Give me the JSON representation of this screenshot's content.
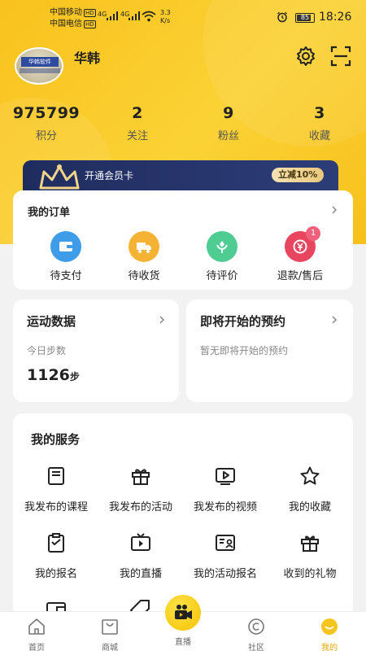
{
  "status": {
    "carrier1": "中国移动",
    "carrier2": "中国电信",
    "hd": "HD",
    "net": "4G",
    "speed_value": "3.3",
    "speed_unit": "K/s",
    "battery": "85",
    "time": "18:26"
  },
  "profile": {
    "avatar_text": "华韩软件",
    "username": "华韩"
  },
  "stats": [
    {
      "value": "975799",
      "label": "积分"
    },
    {
      "value": "2",
      "label": "关注"
    },
    {
      "value": "9",
      "label": "粉丝"
    },
    {
      "value": "3",
      "label": "收藏"
    }
  ],
  "vip": {
    "text": "开通会员卡",
    "tag": "立减10%"
  },
  "orders": {
    "title": "我的订单",
    "items": [
      {
        "label": "待支付",
        "icon": "wallet-icon",
        "color": "#3f9ce8"
      },
      {
        "label": "待收货",
        "icon": "truck-icon",
        "color": "#f5b335"
      },
      {
        "label": "待评价",
        "icon": "flower-icon",
        "color": "#4fcc91"
      },
      {
        "label": "退款/售后",
        "icon": "refund-icon",
        "color": "#e8465f",
        "badge": "1"
      }
    ]
  },
  "sport": {
    "title": "运动数据",
    "sub": "今日步数",
    "steps": "1126",
    "unit": "步"
  },
  "appointment": {
    "title": "即将开始的预约",
    "empty": "暂无即将开始的预约"
  },
  "services": {
    "title": "我的服务",
    "items": [
      {
        "label": "我发布的课程",
        "icon": "course-icon"
      },
      {
        "label": "我发布的活动",
        "icon": "gift-box-icon"
      },
      {
        "label": "我发布的视频",
        "icon": "video-icon"
      },
      {
        "label": "我的收藏",
        "icon": "star-icon"
      },
      {
        "label": "我的报名",
        "icon": "clipboard-icon"
      },
      {
        "label": "我的直播",
        "icon": "tv-icon"
      },
      {
        "label": "我的活动报名",
        "icon": "id-card-icon"
      },
      {
        "label": "收到的礼物",
        "icon": "gift-icon"
      }
    ]
  },
  "tabs": [
    {
      "label": "首页",
      "icon": "home-icon"
    },
    {
      "label": "商城",
      "icon": "shop-bag-icon"
    },
    {
      "label": "直播",
      "icon": "live-camera-icon"
    },
    {
      "label": "社区",
      "icon": "community-icon"
    },
    {
      "label": "我的",
      "icon": "profile-face-icon",
      "active": true
    }
  ],
  "colors": {
    "accent": "#f9c21d",
    "vip_bg": "#1f2c5e",
    "active_tab": "#e7a700"
  }
}
